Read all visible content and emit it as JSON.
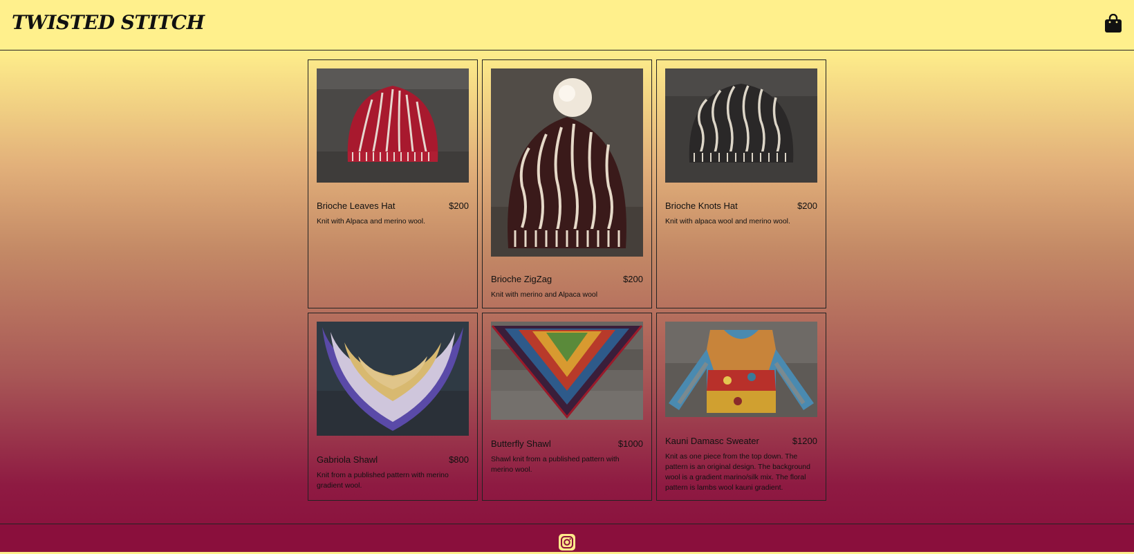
{
  "header": {
    "logo": "TWISTED STITCH",
    "cart_icon": "shopping-bag-icon"
  },
  "products": [
    {
      "name": "Brioche Leaves Hat",
      "price": "$200",
      "description": "Knit with Alpaca and merino wool."
    },
    {
      "name": "Brioche ZigZag",
      "price": "$200",
      "description": "Knit with merino and Alpaca wool"
    },
    {
      "name": "Brioche Knots Hat",
      "price": "$200",
      "description": "Knit with alpaca wool and merino wool."
    },
    {
      "name": "Gabriola Shawl",
      "price": "$800",
      "description": "Knit from a published pattern with merino gradient wool."
    },
    {
      "name": "Butterfly Shawl",
      "price": "$1000",
      "description": "Shawl knit from a published pattern with merino wool."
    },
    {
      "name": "Kauni Damasc Sweater",
      "price": "$1200",
      "description": "Knit as one piece from the top down. The pattern is an original design. The background wool is a gradient marino/silk mix. The floral pattern is lambs wool kauni gradient."
    }
  ],
  "footer": {
    "social_icon": "instagram-icon"
  },
  "colors": {
    "header_bg": "#fff08c",
    "footer_bg": "#8a0f3c",
    "gradient_top": "#fdeb8a",
    "gradient_bottom": "#8a0f3c"
  }
}
